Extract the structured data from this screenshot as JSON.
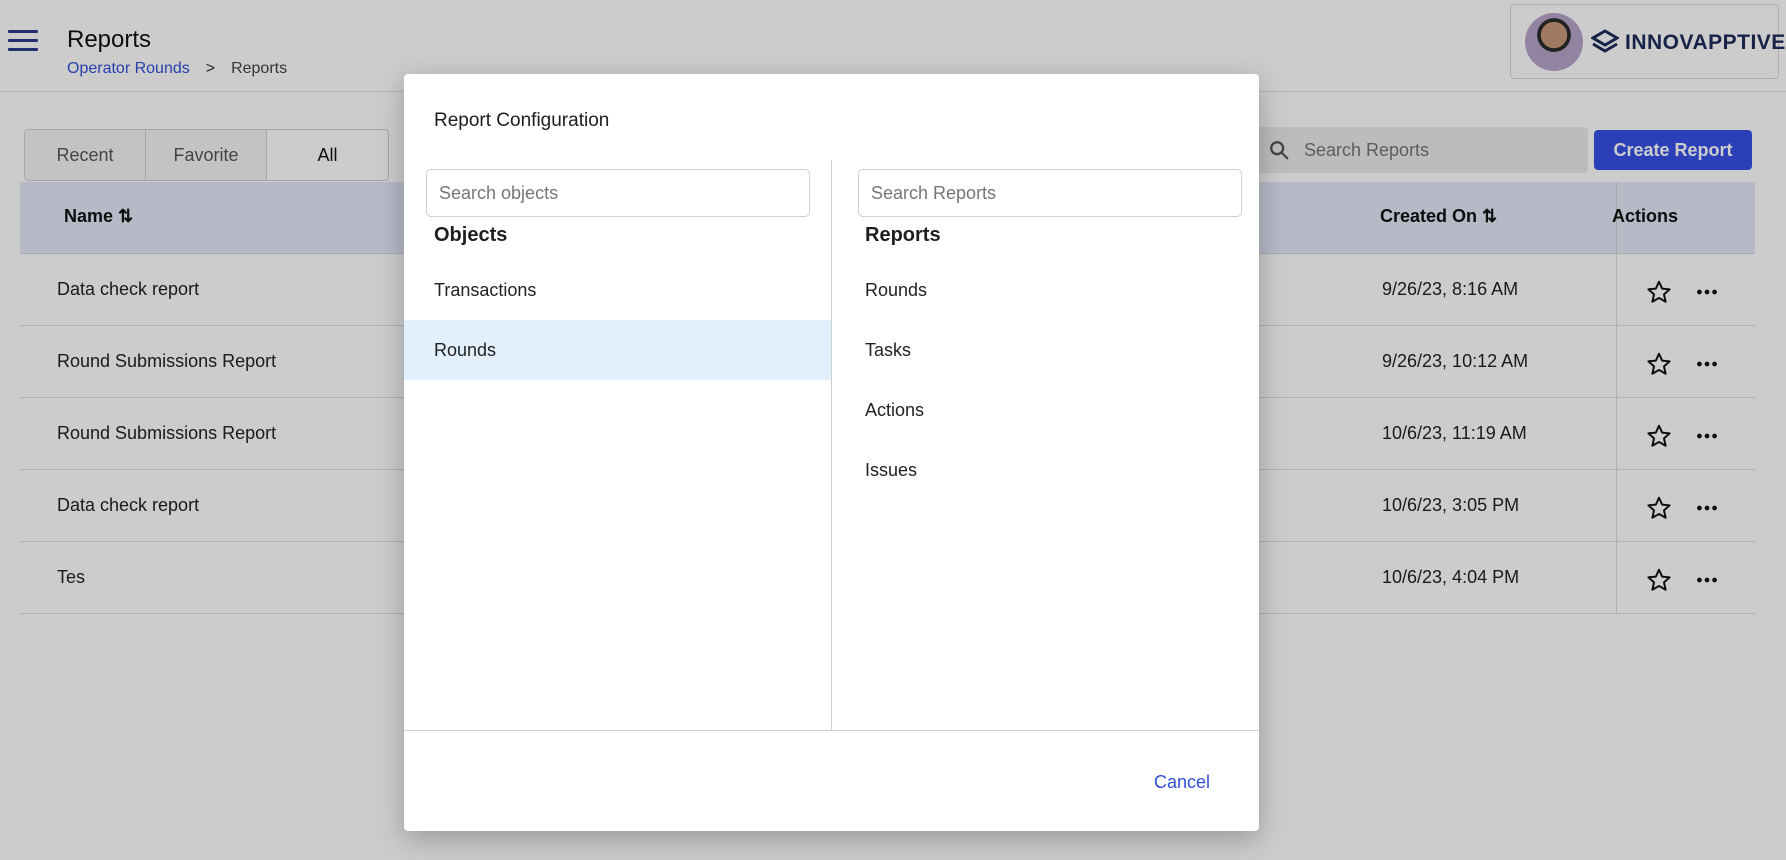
{
  "header": {
    "title": "Reports",
    "breadcrumb": {
      "parent": "Operator Rounds",
      "separator": ">",
      "current": "Reports"
    },
    "brand": "INNOVAPPTIVE"
  },
  "toolbar": {
    "tabs": [
      "Recent",
      "Favorite",
      "All"
    ],
    "active_tab": "All",
    "search_placeholder": "Search Reports",
    "create_label": "Create Report"
  },
  "table": {
    "columns": {
      "name": "Name ⇅",
      "created": "Created On ⇅",
      "actions": "Actions"
    },
    "rows": [
      {
        "name": "Data check report",
        "created": "9/26/23, 8:16 AM"
      },
      {
        "name": "Round Submissions Report",
        "created": "9/26/23, 10:12 AM"
      },
      {
        "name": "Round Submissions Report",
        "created": "10/6/23, 11:19 AM"
      },
      {
        "name": "Data check report",
        "created": "10/6/23, 3:05 PM"
      },
      {
        "name": "Tes",
        "created": "10/6/23, 4:04 PM"
      }
    ]
  },
  "dialog": {
    "title": "Report Configuration",
    "objects": {
      "search_placeholder": "Search objects",
      "heading": "Objects",
      "items": [
        "Transactions",
        "Rounds"
      ],
      "selected": "Rounds"
    },
    "reports": {
      "search_placeholder": "Search Reports",
      "heading": "Reports",
      "items": [
        "Rounds",
        "Tasks",
        "Actions",
        "Issues"
      ]
    },
    "cancel_label": "Cancel"
  },
  "colors": {
    "primary": "#3651e6",
    "link": "#2f4fd9",
    "header_row": "#e3e9f8",
    "selected_item": "#e2f0fd",
    "overlay": "rgba(0,0,0,0.2)"
  },
  "icons": [
    "hamburger-menu-icon",
    "search-icon",
    "sort-icon",
    "star-icon",
    "more-horizontal-icon",
    "innovapptive-logo-icon"
  ]
}
